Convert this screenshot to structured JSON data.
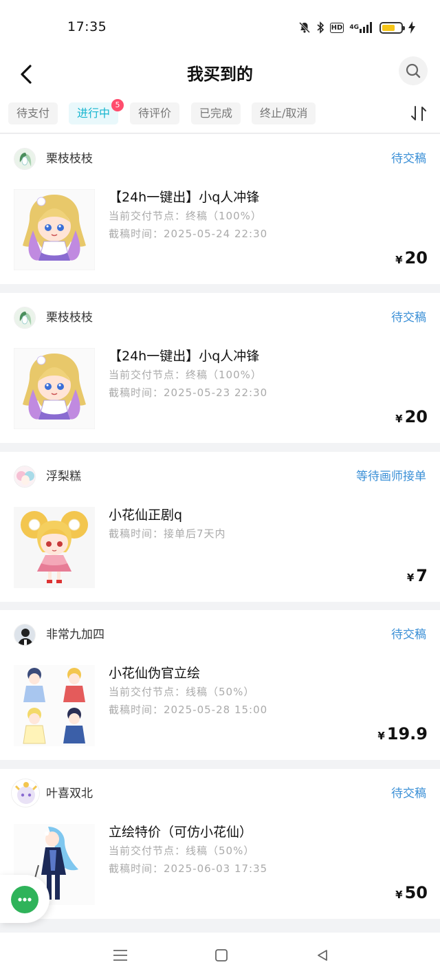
{
  "status_bar": {
    "time": "17:35",
    "icons": [
      "mute-bell-icon",
      "bluetooth-icon",
      "hd-icon",
      "4g-signal-icon",
      "battery-icon",
      "charging-icon"
    ],
    "hd_label": "HD",
    "network_label": "4G",
    "battery_level": 0.7,
    "battery_color": "#f5c518"
  },
  "header": {
    "title": "我买到的",
    "back_icon": "chevron-left-icon",
    "search_icon": "search-icon"
  },
  "tabs": [
    {
      "label": "待支付",
      "active": false
    },
    {
      "label": "进行中",
      "active": true,
      "badge": "5"
    },
    {
      "label": "待评价",
      "active": false
    },
    {
      "label": "已完成",
      "active": false
    },
    {
      "label": "终止/取消",
      "active": false
    }
  ],
  "sort_icon": "sort-arrows-icon",
  "orders": [
    {
      "seller": "栗枝枝枝",
      "status": "待交稿",
      "title": "【24h一键出】小q人冲锋",
      "line1": "当前交付节点：终稿（100%）",
      "line2": "截稿时间：2025-05-24 22:30",
      "currency": "¥",
      "price": "20"
    },
    {
      "seller": "栗枝枝枝",
      "status": "待交稿",
      "title": "【24h一键出】小q人冲锋",
      "line1": "当前交付节点：终稿（100%）",
      "line2": "截稿时间：2025-05-23 22:30",
      "currency": "¥",
      "price": "20"
    },
    {
      "seller": "浮梨糕",
      "status": "等待画师接单",
      "title": "小花仙正剧q",
      "line1": "截稿时间：接单后7天内",
      "line2": "",
      "currency": "¥",
      "price": "7"
    },
    {
      "seller": "非常九加四",
      "status": "待交稿",
      "title": "小花仙伪官立绘",
      "line1": "当前交付节点：线稿（50%）",
      "line2": "截稿时间：2025-05-28 15:00",
      "currency": "¥",
      "price": "19.9"
    },
    {
      "seller": "叶喜双北",
      "status": "待交稿",
      "title": "立绘特价（可仿小花仙）",
      "line1": "当前交付节点：线稿（50%）",
      "line2": "截稿时间：2025-06-03 17:35",
      "currency": "¥",
      "price": "50"
    }
  ],
  "fab": {
    "icon": "chat-bubble-icon",
    "color": "#2fb35a"
  },
  "nav_bar": {
    "icons": [
      "menu-icon",
      "home-square-icon",
      "back-triangle-icon"
    ]
  },
  "colors": {
    "accent": "#16b5cf",
    "status_blue": "#3a8fd6",
    "badge_red": "#ff4d6d"
  }
}
